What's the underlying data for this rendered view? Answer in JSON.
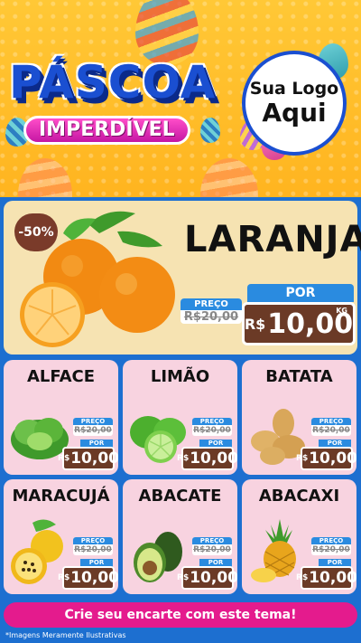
{
  "header": {
    "title": "PÁSCOA",
    "subtitle": "IMPERDÍVEL",
    "logo_line1": "Sua Logo",
    "logo_line2": "Aqui"
  },
  "featured": {
    "discount": "-50%",
    "name": "LARANJA",
    "old_label": "PREÇO",
    "old_price": "R$20,00",
    "por_label": "POR",
    "currency": "R$",
    "price": "10,00",
    "unit": "KG"
  },
  "products": [
    {
      "name": "ALFACE",
      "old_label": "PREÇO",
      "old_price": "R$20,00",
      "por_label": "POR",
      "currency": "R$",
      "price": "10,00"
    },
    {
      "name": "LIMÃO",
      "old_label": "PREÇO",
      "old_price": "R$20,00",
      "por_label": "POR",
      "currency": "R$",
      "price": "10,00"
    },
    {
      "name": "BATATA",
      "old_label": "PREÇO",
      "old_price": "R$20,00",
      "por_label": "POR",
      "currency": "R$",
      "price": "10,00"
    },
    {
      "name": "MARACUJÁ",
      "old_label": "PREÇO",
      "old_price": "R$20,00",
      "por_label": "POR",
      "currency": "R$",
      "price": "10,00"
    },
    {
      "name": "ABACATE",
      "old_label": "PREÇO",
      "old_price": "R$20,00",
      "por_label": "POR",
      "currency": "R$",
      "price": "10,00"
    },
    {
      "name": "ABACAXI",
      "old_label": "PREÇO",
      "old_price": "R$20,00",
      "por_label": "POR",
      "currency": "R$",
      "price": "10,00"
    }
  ],
  "footer": {
    "cta": "Crie seu encarte com este tema!",
    "disclaimer": "*Imagens Meramente Ilustrativas"
  },
  "colors": {
    "header_bg": "#ffb41f",
    "panel_bg": "#1d6fd0",
    "card_bg": "#f8d3e0",
    "featured_bg": "#f6e3b2",
    "price_tag": "#6b3a26",
    "accent_blue": "#2a8be0",
    "cta": "#e41b8d"
  }
}
